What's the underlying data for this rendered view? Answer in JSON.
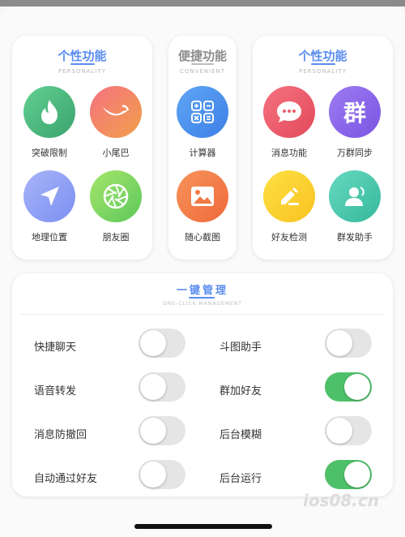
{
  "colors": {
    "accent_blue": "#5b8df0",
    "gray_title": "#8c8c8c",
    "toggle_on": "#4fc06a",
    "toggle_off": "#e5e5e6"
  },
  "cards": [
    {
      "title": "个性功能",
      "subtitle": "PERSONALITY",
      "apps": [
        {
          "label": "突破限制",
          "icon": "flame-icon"
        },
        {
          "label": "小尾巴",
          "icon": "tail-icon"
        },
        {
          "label": "地理位置",
          "icon": "location-arrow-icon"
        },
        {
          "label": "朋友圈",
          "icon": "aperture-icon"
        }
      ]
    },
    {
      "title": "便捷功能",
      "subtitle": "CONVENIENT",
      "apps": [
        {
          "label": "计算器",
          "icon": "calculator-icon"
        },
        {
          "label": "随心截图",
          "icon": "image-icon"
        }
      ]
    },
    {
      "title": "个性功能",
      "subtitle": "PERSONALITY",
      "apps": [
        {
          "label": "消息功能",
          "icon": "chat-bubble-icon"
        },
        {
          "label": "万群同步",
          "icon": "qun-character-icon",
          "glyph": "群"
        },
        {
          "label": "好友检测",
          "icon": "pencil-note-icon"
        },
        {
          "label": "群发助手",
          "icon": "person-icon"
        }
      ]
    }
  ],
  "management": {
    "title": "一键管理",
    "subtitle": "ONE-CLICK MANAGEMENT",
    "toggles": [
      {
        "label": "快捷聊天",
        "on": false
      },
      {
        "label": "斗图助手",
        "on": false
      },
      {
        "label": "语音转发",
        "on": false
      },
      {
        "label": "群加好友",
        "on": true
      },
      {
        "label": "消息防撤回",
        "on": false
      },
      {
        "label": "后台模糊",
        "on": false
      },
      {
        "label": "自动通过好友",
        "on": false
      },
      {
        "label": "后台运行",
        "on": true
      }
    ]
  },
  "watermark": "ios08.cn"
}
